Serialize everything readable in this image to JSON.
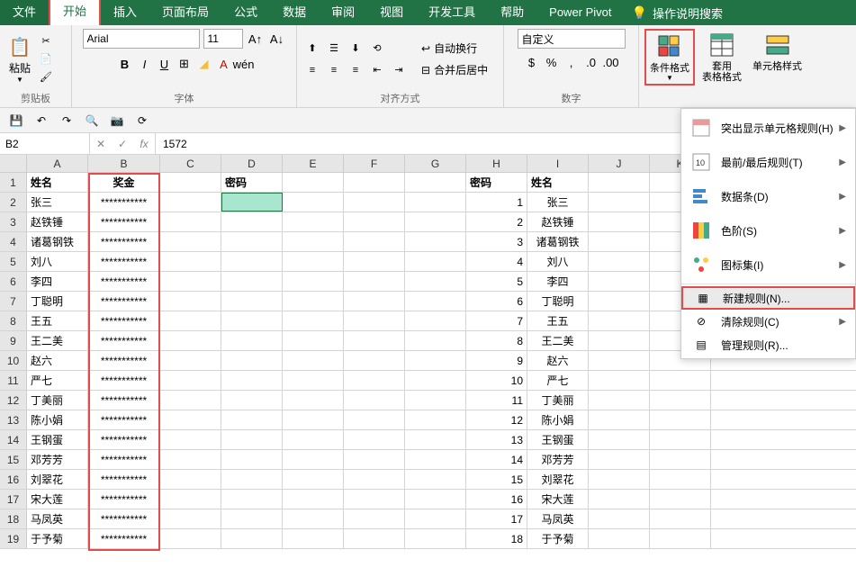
{
  "tabs": {
    "file": "文件",
    "home": "开始",
    "insert": "插入",
    "layout": "页面布局",
    "formulas": "公式",
    "data": "数据",
    "review": "审阅",
    "view": "视图",
    "developer": "开发工具",
    "help": "帮助",
    "powerpivot": "Power Pivot",
    "tellme": "操作说明搜索"
  },
  "ribbon": {
    "clipboard": {
      "label": "剪贴板",
      "paste": "粘贴"
    },
    "font": {
      "label": "字体",
      "name": "Arial",
      "size": "11"
    },
    "alignment": {
      "label": "对齐方式",
      "wrap": "自动换行",
      "merge": "合并后居中"
    },
    "number": {
      "label": "数字",
      "format": "自定义"
    },
    "styles": {
      "conditional": "条件格式",
      "table": "套用\n表格格式",
      "table1": "套用",
      "table2": "表格格式",
      "cell": "单元格样式"
    }
  },
  "formula_bar": {
    "cell": "B2",
    "value": "1572"
  },
  "columns": [
    "A",
    "B",
    "C",
    "D",
    "E",
    "F",
    "G",
    "H",
    "I",
    "J",
    "K"
  ],
  "headers": {
    "A": "姓名",
    "B": "奖金",
    "D": "密码",
    "H": "密码",
    "I": "姓名"
  },
  "rows": [
    {
      "n": 1
    },
    {
      "n": 2,
      "A": "张三",
      "B": "***********",
      "H": "1",
      "I": "张三"
    },
    {
      "n": 3,
      "A": "赵铁锤",
      "B": "***********",
      "H": "2",
      "I": "赵铁锤"
    },
    {
      "n": 4,
      "A": "诸葛钢铁",
      "B": "***********",
      "H": "3",
      "I": "诸葛钢铁"
    },
    {
      "n": 5,
      "A": "刘八",
      "B": "***********",
      "H": "4",
      "I": "刘八"
    },
    {
      "n": 6,
      "A": "李四",
      "B": "***********",
      "H": "5",
      "I": "李四"
    },
    {
      "n": 7,
      "A": "丁聪明",
      "B": "***********",
      "H": "6",
      "I": "丁聪明"
    },
    {
      "n": 8,
      "A": "王五",
      "B": "***********",
      "H": "7",
      "I": "王五"
    },
    {
      "n": 9,
      "A": "王二美",
      "B": "***********",
      "H": "8",
      "I": "王二美"
    },
    {
      "n": 10,
      "A": "赵六",
      "B": "***********",
      "H": "9",
      "I": "赵六"
    },
    {
      "n": 11,
      "A": "严七",
      "B": "***********",
      "H": "10",
      "I": "严七"
    },
    {
      "n": 12,
      "A": "丁美丽",
      "B": "***********",
      "H": "11",
      "I": "丁美丽"
    },
    {
      "n": 13,
      "A": "陈小娟",
      "B": "***********",
      "H": "12",
      "I": "陈小娟"
    },
    {
      "n": 14,
      "A": "王钢蛋",
      "B": "***********",
      "H": "13",
      "I": "王钢蛋"
    },
    {
      "n": 15,
      "A": "邓芳芳",
      "B": "***********",
      "H": "14",
      "I": "邓芳芳"
    },
    {
      "n": 16,
      "A": "刘翠花",
      "B": "***********",
      "H": "15",
      "I": "刘翠花"
    },
    {
      "n": 17,
      "A": "宋大莲",
      "B": "***********",
      "H": "16",
      "I": "宋大莲"
    },
    {
      "n": 18,
      "A": "马凤英",
      "B": "***********",
      "H": "17",
      "I": "马凤英"
    },
    {
      "n": 19,
      "A": "于予菊",
      "B": "***********",
      "H": "18",
      "I": "于予菊"
    }
  ],
  "menu": {
    "highlight": "突出显示单元格规则(H)",
    "toprules": "最前/最后规则(T)",
    "databars": "数据条(D)",
    "colorscales": "色阶(S)",
    "iconsets": "图标集(I)",
    "newrule": "新建规则(N)...",
    "clear": "清除规则(C)",
    "manage": "管理规则(R)..."
  }
}
